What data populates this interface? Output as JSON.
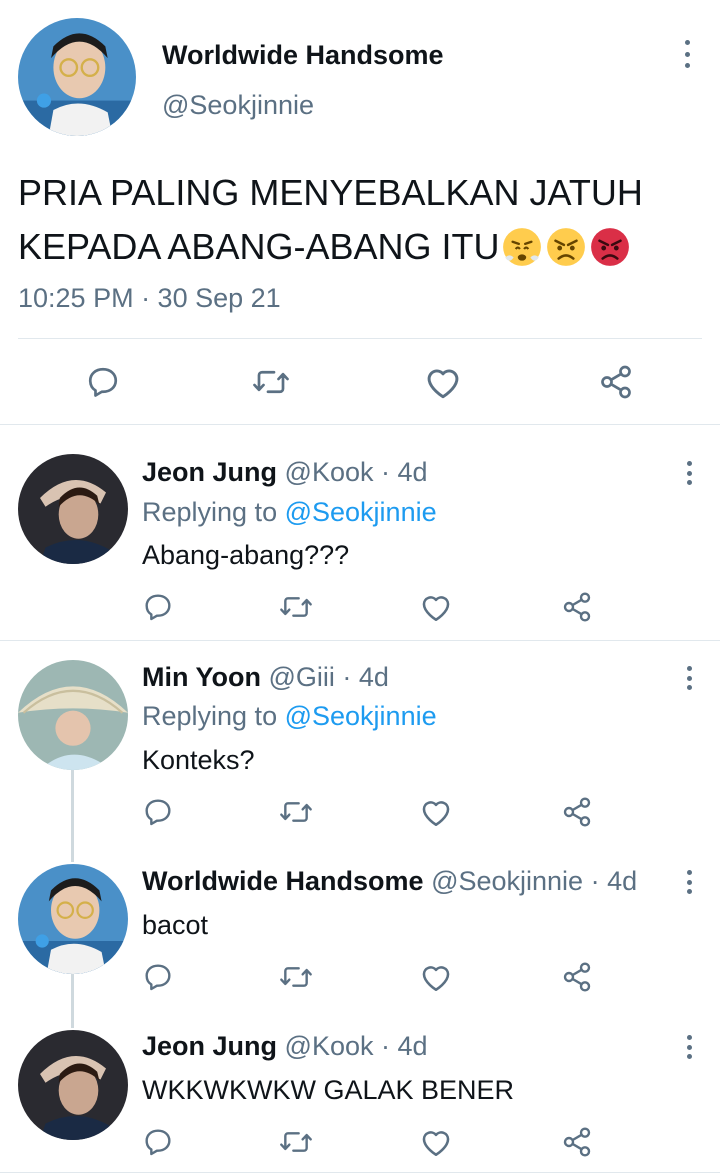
{
  "main_tweet": {
    "display_name": "Worldwide Handsome",
    "handle": "@Seokjinnie",
    "text_line1": "PRIA PALING MENYEBALKAN JATUH",
    "text_line2": "KEPADA ABANG-ABANG ITU",
    "emojis": [
      "face-with-steam-emoji",
      "angry-face-emoji",
      "pouting-face-emoji"
    ],
    "timestamp": "10:25 PM · 30 Sep 21",
    "avatar": "avatar-seokjin"
  },
  "replies": [
    {
      "display_name": "Jeon Jung",
      "handle": "@Kook",
      "age": "· 4d",
      "replying_prefix": "Replying to",
      "replying_to": "@Seokjinnie",
      "text": "Abang-abang???",
      "avatar": "avatar-kook"
    },
    {
      "display_name": "Min Yoon",
      "handle": "@Giii",
      "age": "· 4d",
      "replying_prefix": "Replying to",
      "replying_to": "@Seokjinnie",
      "text": "Konteks?",
      "avatar": "avatar-giii"
    },
    {
      "display_name": "Worldwide Handsome",
      "handle": "@Seokjinnie",
      "age": "· 4d",
      "text": "bacot",
      "avatar": "avatar-seokjin"
    },
    {
      "display_name": "Jeon Jung",
      "handle": "@Kook",
      "age": "· 4d",
      "text": "WKKWKWKW GALAK BENER",
      "avatar": "avatar-kook"
    }
  ],
  "colors": {
    "link": "#1d9bf0",
    "muted": "#5b7083",
    "divider": "#e1e8ed"
  },
  "icons": [
    "reply-icon",
    "retweet-icon",
    "like-icon",
    "share-icon",
    "more-icon"
  ]
}
